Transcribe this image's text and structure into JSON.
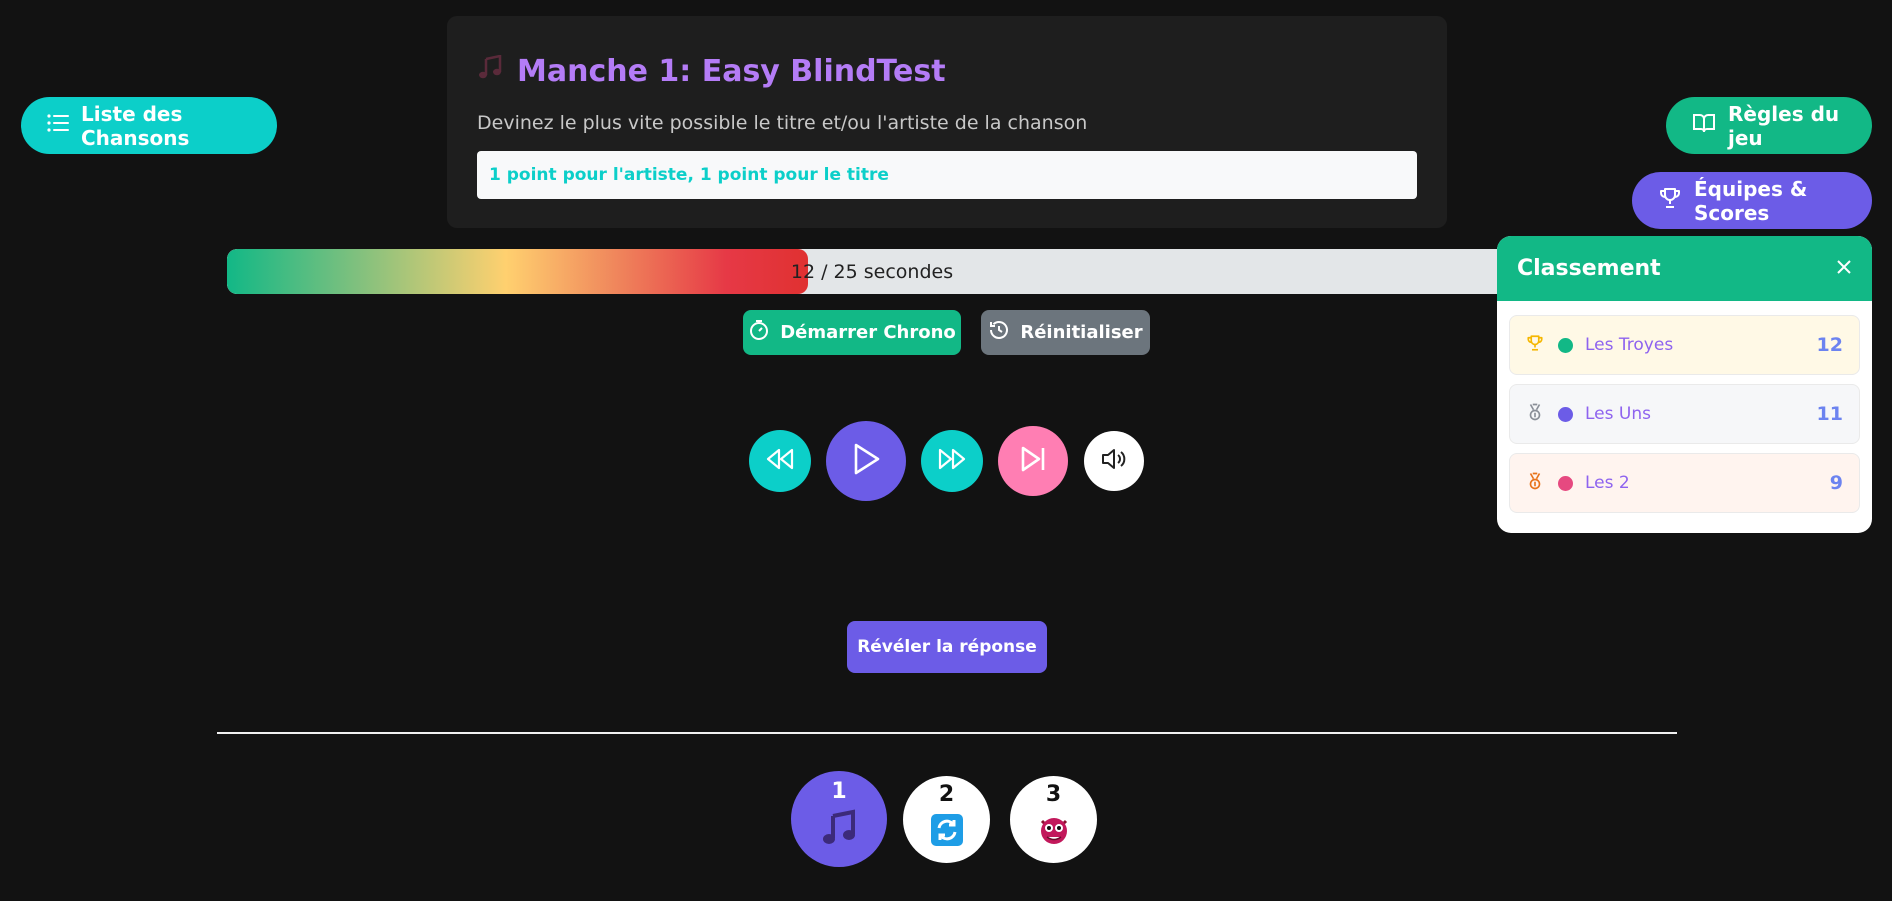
{
  "nav": {
    "songs_list_label": "Liste des Chansons",
    "rules_label": "Règles du jeu",
    "teams_label": "Équipes & Scores"
  },
  "round": {
    "title": "Manche 1: Easy BlindTest",
    "subtitle": "Devinez le plus vite possible le titre et/ou l'artiste de la chanson",
    "points_info": "1 point pour l'artiste, 1 point pour le titre"
  },
  "timer": {
    "elapsed": 12,
    "total": 25,
    "text": "12 / 25 secondes",
    "progress_fraction": 0.45,
    "start_label": "Démarrer Chrono",
    "reset_label": "Réinitialiser"
  },
  "player": {
    "controls": [
      "rewind",
      "play",
      "fast-forward",
      "skip",
      "volume"
    ]
  },
  "reveal_label": "Révéler la réponse",
  "rounds": [
    {
      "number": "1",
      "icon": "music-note-icon",
      "active": true
    },
    {
      "number": "2",
      "icon": "refresh-icon",
      "active": false
    },
    {
      "number": "3",
      "icon": "monster-icon",
      "active": false
    }
  ],
  "ranking": {
    "title": "Classement",
    "teams": [
      {
        "name": "Les Troyes",
        "score": "12",
        "medal": "trophy-icon",
        "dot_color": "#12b886",
        "bg": "#fff9e6"
      },
      {
        "name": "Les Uns",
        "score": "11",
        "medal": "silver-medal-icon",
        "dot_color": "#6c5ce7",
        "bg": "#f6f7f9"
      },
      {
        "name": "Les 2",
        "score": "9",
        "medal": "bronze-medal-icon",
        "dot_color": "#e64980",
        "bg": "#fff4ef"
      }
    ]
  },
  "colors": {
    "accent_cyan": "#0ccfc9",
    "accent_green": "#12b886",
    "accent_purple": "#6c5ce7",
    "title_purple": "#b47cf6",
    "skip_pink": "#ff7eb3"
  }
}
